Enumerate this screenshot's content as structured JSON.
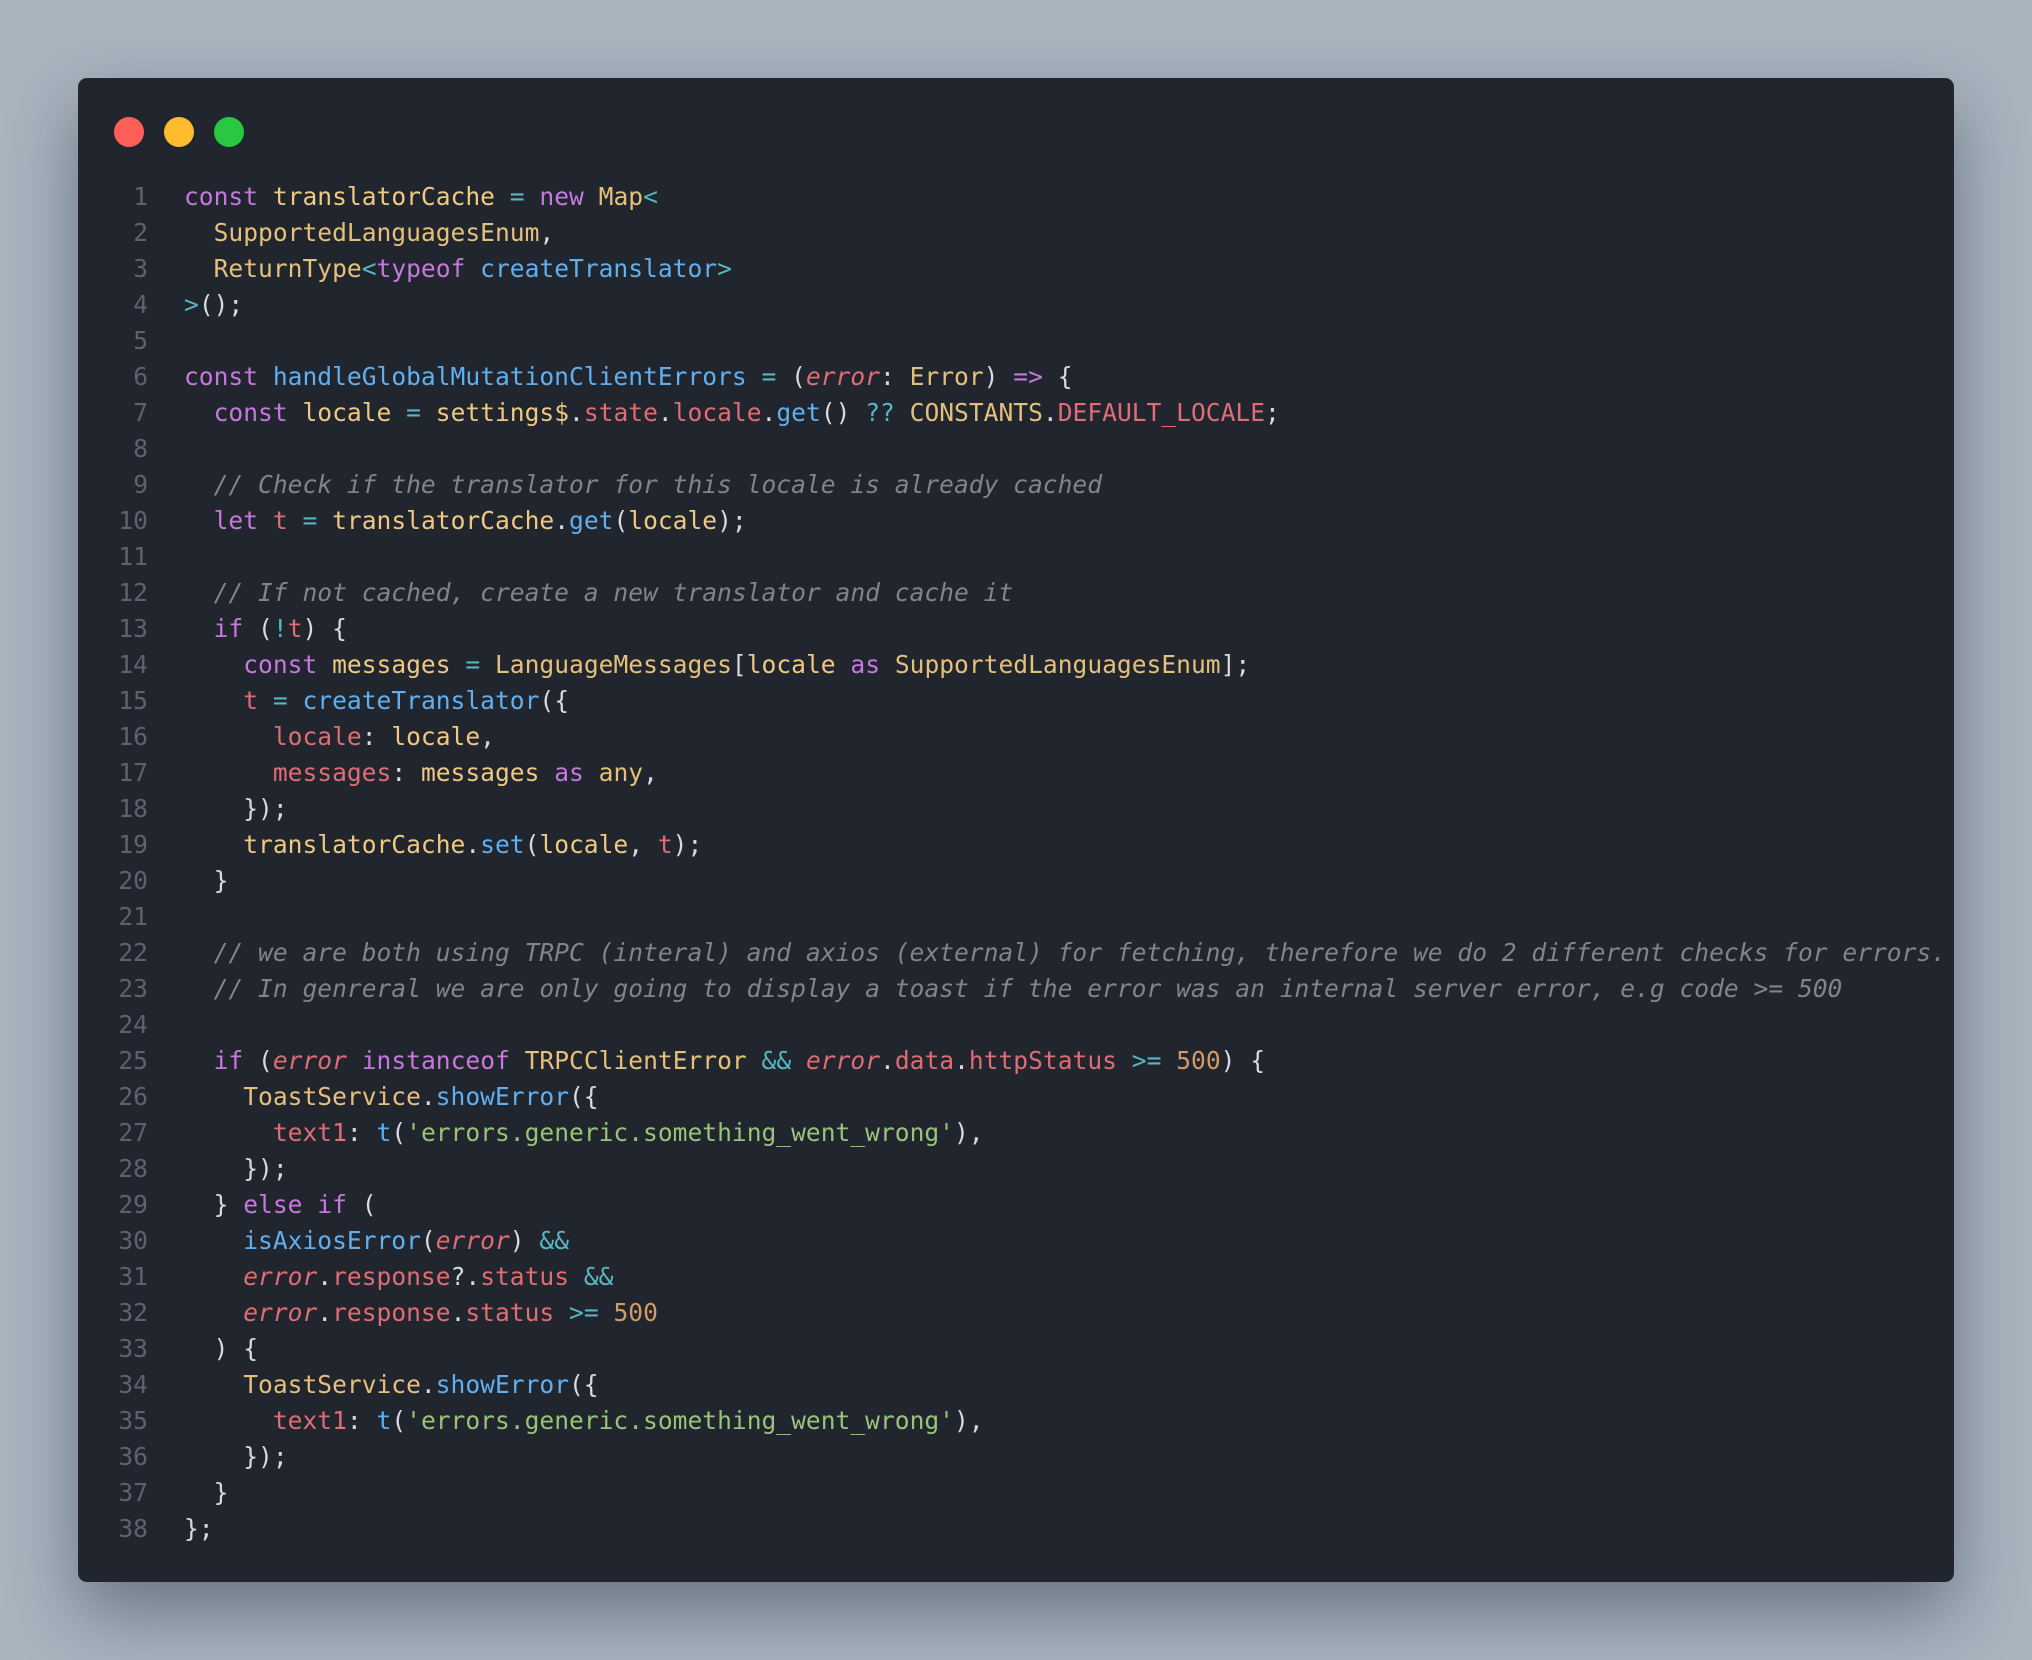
{
  "window": {
    "controls": [
      {
        "name": "close",
        "color": "#ff5f57"
      },
      {
        "name": "minimize",
        "color": "#febc2e"
      },
      {
        "name": "maximize",
        "color": "#28c840"
      }
    ]
  },
  "code": {
    "lines": [
      [
        [
          "keyword",
          "const"
        ],
        [
          "plain",
          " "
        ],
        [
          "var",
          "translatorCache"
        ],
        [
          "plain",
          " "
        ],
        [
          "op",
          "="
        ],
        [
          "plain",
          " "
        ],
        [
          "keyword",
          "new"
        ],
        [
          "plain",
          " "
        ],
        [
          "type",
          "Map"
        ],
        [
          "op",
          "<"
        ]
      ],
      [
        [
          "plain",
          "  "
        ],
        [
          "type",
          "SupportedLanguagesEnum"
        ],
        [
          "plain",
          ","
        ]
      ],
      [
        [
          "plain",
          "  "
        ],
        [
          "type",
          "ReturnType"
        ],
        [
          "op",
          "<"
        ],
        [
          "keyword",
          "typeof"
        ],
        [
          "plain",
          " "
        ],
        [
          "func",
          "createTranslator"
        ],
        [
          "op",
          ">"
        ]
      ],
      [
        [
          "op",
          ">"
        ],
        [
          "plain",
          "();"
        ]
      ],
      [],
      [
        [
          "keyword",
          "const"
        ],
        [
          "plain",
          " "
        ],
        [
          "func",
          "handleGlobalMutationClientErrors"
        ],
        [
          "plain",
          " "
        ],
        [
          "op",
          "="
        ],
        [
          "plain",
          " ("
        ],
        [
          "param",
          "error"
        ],
        [
          "plain",
          ": "
        ],
        [
          "type",
          "Error"
        ],
        [
          "plain",
          ") "
        ],
        [
          "keyword",
          "=>"
        ],
        [
          "plain",
          " {"
        ]
      ],
      [
        [
          "plain",
          "  "
        ],
        [
          "keyword",
          "const"
        ],
        [
          "plain",
          " "
        ],
        [
          "var",
          "locale"
        ],
        [
          "plain",
          " "
        ],
        [
          "op",
          "="
        ],
        [
          "plain",
          " "
        ],
        [
          "var",
          "settings$"
        ],
        [
          "plain",
          "."
        ],
        [
          "prop",
          "state"
        ],
        [
          "plain",
          "."
        ],
        [
          "prop",
          "locale"
        ],
        [
          "plain",
          "."
        ],
        [
          "func",
          "get"
        ],
        [
          "plain",
          "() "
        ],
        [
          "op",
          "??"
        ],
        [
          "plain",
          " "
        ],
        [
          "type",
          "CONSTANTS"
        ],
        [
          "plain",
          "."
        ],
        [
          "prop",
          "DEFAULT_LOCALE"
        ],
        [
          "plain",
          ";"
        ]
      ],
      [],
      [
        [
          "plain",
          "  "
        ],
        [
          "comment",
          "// Check if the translator for this locale is already cached"
        ]
      ],
      [
        [
          "plain",
          "  "
        ],
        [
          "keyword",
          "let"
        ],
        [
          "plain",
          " "
        ],
        [
          "prop",
          "t"
        ],
        [
          "plain",
          " "
        ],
        [
          "op",
          "="
        ],
        [
          "plain",
          " "
        ],
        [
          "var",
          "translatorCache"
        ],
        [
          "plain",
          "."
        ],
        [
          "func",
          "get"
        ],
        [
          "plain",
          "("
        ],
        [
          "var",
          "locale"
        ],
        [
          "plain",
          ");"
        ]
      ],
      [],
      [
        [
          "plain",
          "  "
        ],
        [
          "comment",
          "// If not cached, create a new translator and cache it"
        ]
      ],
      [
        [
          "plain",
          "  "
        ],
        [
          "keyword",
          "if"
        ],
        [
          "plain",
          " ("
        ],
        [
          "op",
          "!"
        ],
        [
          "prop",
          "t"
        ],
        [
          "plain",
          ") {"
        ]
      ],
      [
        [
          "plain",
          "    "
        ],
        [
          "keyword",
          "const"
        ],
        [
          "plain",
          " "
        ],
        [
          "var",
          "messages"
        ],
        [
          "plain",
          " "
        ],
        [
          "op",
          "="
        ],
        [
          "plain",
          " "
        ],
        [
          "type",
          "LanguageMessages"
        ],
        [
          "plain",
          "["
        ],
        [
          "var",
          "locale"
        ],
        [
          "plain",
          " "
        ],
        [
          "keyword",
          "as"
        ],
        [
          "plain",
          " "
        ],
        [
          "type",
          "SupportedLanguagesEnum"
        ],
        [
          "plain",
          "];"
        ]
      ],
      [
        [
          "plain",
          "    "
        ],
        [
          "prop",
          "t"
        ],
        [
          "plain",
          " "
        ],
        [
          "op",
          "="
        ],
        [
          "plain",
          " "
        ],
        [
          "func",
          "createTranslator"
        ],
        [
          "plain",
          "({"
        ]
      ],
      [
        [
          "plain",
          "      "
        ],
        [
          "prop",
          "locale"
        ],
        [
          "plain",
          ": "
        ],
        [
          "var",
          "locale"
        ],
        [
          "plain",
          ","
        ]
      ],
      [
        [
          "plain",
          "      "
        ],
        [
          "prop",
          "messages"
        ],
        [
          "plain",
          ": "
        ],
        [
          "var",
          "messages"
        ],
        [
          "plain",
          " "
        ],
        [
          "keyword",
          "as"
        ],
        [
          "plain",
          " "
        ],
        [
          "type",
          "any"
        ],
        [
          "plain",
          ","
        ]
      ],
      [
        [
          "plain",
          "    });"
        ]
      ],
      [
        [
          "plain",
          "    "
        ],
        [
          "var",
          "translatorCache"
        ],
        [
          "plain",
          "."
        ],
        [
          "func",
          "set"
        ],
        [
          "plain",
          "("
        ],
        [
          "var",
          "locale"
        ],
        [
          "plain",
          ", "
        ],
        [
          "prop",
          "t"
        ],
        [
          "plain",
          ");"
        ]
      ],
      [
        [
          "plain",
          "  }"
        ]
      ],
      [],
      [
        [
          "plain",
          "  "
        ],
        [
          "comment",
          "// we are both using TRPC (interal) and axios (external) for fetching, therefore we do 2 different checks for errors."
        ]
      ],
      [
        [
          "plain",
          "  "
        ],
        [
          "comment",
          "// In genreral we are only going to display a toast if the error was an internal server error, e.g code >= 500"
        ]
      ],
      [],
      [
        [
          "plain",
          "  "
        ],
        [
          "keyword",
          "if"
        ],
        [
          "plain",
          " ("
        ],
        [
          "param",
          "error"
        ],
        [
          "plain",
          " "
        ],
        [
          "keyword",
          "instanceof"
        ],
        [
          "plain",
          " "
        ],
        [
          "type",
          "TRPCClientError"
        ],
        [
          "plain",
          " "
        ],
        [
          "op",
          "&&"
        ],
        [
          "plain",
          " "
        ],
        [
          "param",
          "error"
        ],
        [
          "plain",
          "."
        ],
        [
          "prop",
          "data"
        ],
        [
          "plain",
          "."
        ],
        [
          "prop",
          "httpStatus"
        ],
        [
          "plain",
          " "
        ],
        [
          "op",
          ">="
        ],
        [
          "plain",
          " "
        ],
        [
          "number",
          "500"
        ],
        [
          "plain",
          ") {"
        ]
      ],
      [
        [
          "plain",
          "    "
        ],
        [
          "type",
          "ToastService"
        ],
        [
          "plain",
          "."
        ],
        [
          "func",
          "showError"
        ],
        [
          "plain",
          "({"
        ]
      ],
      [
        [
          "plain",
          "      "
        ],
        [
          "prop",
          "text1"
        ],
        [
          "plain",
          ": "
        ],
        [
          "func",
          "t"
        ],
        [
          "plain",
          "("
        ],
        [
          "string",
          "'errors.generic.something_went_wrong'"
        ],
        [
          "plain",
          "),"
        ]
      ],
      [
        [
          "plain",
          "    });"
        ]
      ],
      [
        [
          "plain",
          "  } "
        ],
        [
          "keyword",
          "else"
        ],
        [
          "plain",
          " "
        ],
        [
          "keyword",
          "if"
        ],
        [
          "plain",
          " ("
        ]
      ],
      [
        [
          "plain",
          "    "
        ],
        [
          "func",
          "isAxiosError"
        ],
        [
          "plain",
          "("
        ],
        [
          "param",
          "error"
        ],
        [
          "plain",
          ") "
        ],
        [
          "op",
          "&&"
        ]
      ],
      [
        [
          "plain",
          "    "
        ],
        [
          "param",
          "error"
        ],
        [
          "plain",
          "."
        ],
        [
          "prop",
          "response"
        ],
        [
          "plain",
          "?."
        ],
        [
          "prop",
          "status"
        ],
        [
          "plain",
          " "
        ],
        [
          "op",
          "&&"
        ]
      ],
      [
        [
          "plain",
          "    "
        ],
        [
          "param",
          "error"
        ],
        [
          "plain",
          "."
        ],
        [
          "prop",
          "response"
        ],
        [
          "plain",
          "."
        ],
        [
          "prop",
          "status"
        ],
        [
          "plain",
          " "
        ],
        [
          "op",
          ">="
        ],
        [
          "plain",
          " "
        ],
        [
          "number",
          "500"
        ]
      ],
      [
        [
          "plain",
          "  ) {"
        ]
      ],
      [
        [
          "plain",
          "    "
        ],
        [
          "type",
          "ToastService"
        ],
        [
          "plain",
          "."
        ],
        [
          "func",
          "showError"
        ],
        [
          "plain",
          "({"
        ]
      ],
      [
        [
          "plain",
          "      "
        ],
        [
          "prop",
          "text1"
        ],
        [
          "plain",
          ": "
        ],
        [
          "func",
          "t"
        ],
        [
          "plain",
          "("
        ],
        [
          "string",
          "'errors.generic.something_went_wrong'"
        ],
        [
          "plain",
          "),"
        ]
      ],
      [
        [
          "plain",
          "    });"
        ]
      ],
      [
        [
          "plain",
          "  }"
        ]
      ],
      [
        [
          "plain",
          "};"
        ]
      ]
    ]
  }
}
